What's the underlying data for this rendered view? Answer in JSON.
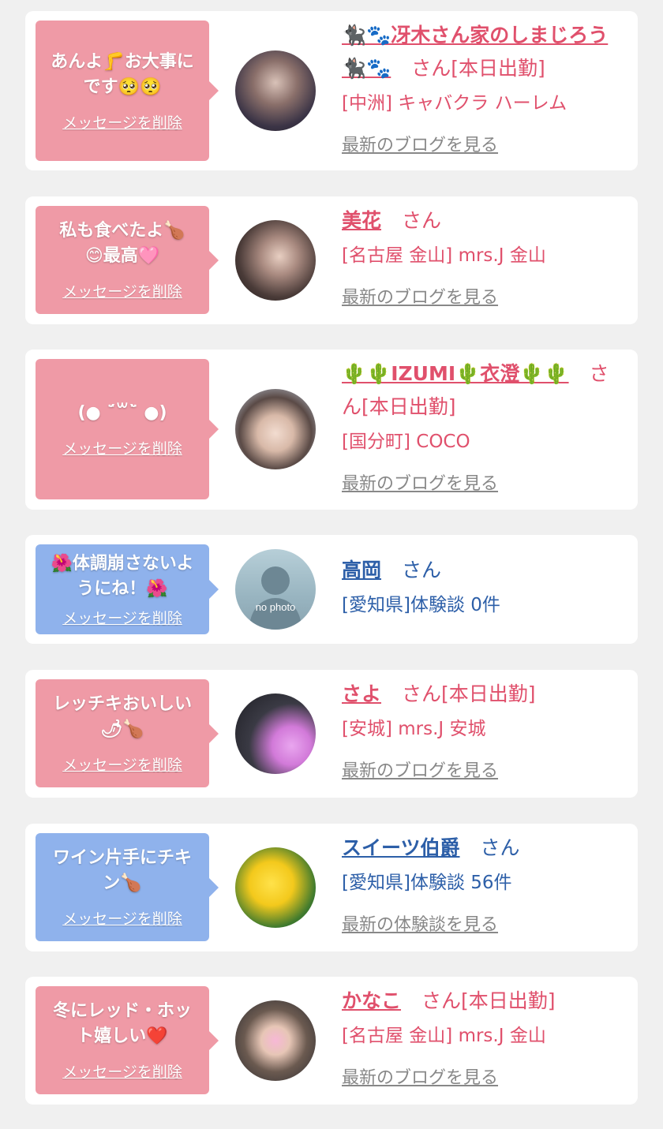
{
  "delete_label": "メッセージを削除",
  "san_label": "さん",
  "colors": {
    "page_bg": "#f0f0f0",
    "pink_bubble": "#ef9aa6",
    "blue_bubble": "#8fb2ec",
    "pink_text": "#e0506c",
    "blue_text": "#2d5fa8",
    "link_gray": "#888888"
  },
  "items": [
    {
      "message_lines": [
        "あんよ🦵お大事に",
        "です🥺🥺"
      ],
      "name": "🐈‍⬛🐾冴木さん家のしまじろう🐈‍⬛🐾",
      "status": "[本日出勤]",
      "location": "[中洲] キャバクラ ハーレム",
      "link": "最新のブログを見る",
      "avatar": "cast-photo"
    },
    {
      "message_lines": [
        "私も食べたよ🍗",
        "😊最高🩷"
      ],
      "name": "美花",
      "status": "",
      "location": "[名古屋 金山] mrs.J 金山",
      "link": "最新のブログを見る",
      "avatar": "cast-photo"
    },
    {
      "message_lines": [
        "(● ˊ̈꒳ˋ̈ ●)"
      ],
      "name": "🌵🌵IZUMI🌵衣澄🌵🌵",
      "status": "[本日出勤]",
      "location": "[国分町] COCO",
      "link": "最新のブログを見る",
      "avatar": "cast-photo"
    },
    {
      "message_lines": [
        "🌺体調崩さないよ",
        "うにね！🌺"
      ],
      "name": "高岡",
      "status": "",
      "location": "[愛知県]体験談 0件",
      "link": "",
      "avatar": "no-photo",
      "avatar_text": "no photo"
    },
    {
      "message_lines": [
        "レッチキおいしい",
        "🌶🍗"
      ],
      "name": "さよ",
      "status": "[本日出勤]",
      "location": "[安城] mrs.J 安城",
      "link": "最新のブログを見る",
      "avatar": "cast-photo"
    },
    {
      "message_lines": [
        "ワイン片手にチキ",
        "ン🍗"
      ],
      "name": "スイーツ伯爵",
      "status": "",
      "location": "[愛知県]体験談 56件",
      "link": "最新の体験談を見る",
      "avatar": "flower-photo"
    },
    {
      "message_lines": [
        "冬にレッド・ホッ",
        "ト嬉しい❤️"
      ],
      "name": "かなこ",
      "status": "[本日出勤]",
      "location": "[名古屋 金山] mrs.J 金山",
      "link": "最新のブログを見る",
      "avatar": "cast-photo"
    }
  ]
}
